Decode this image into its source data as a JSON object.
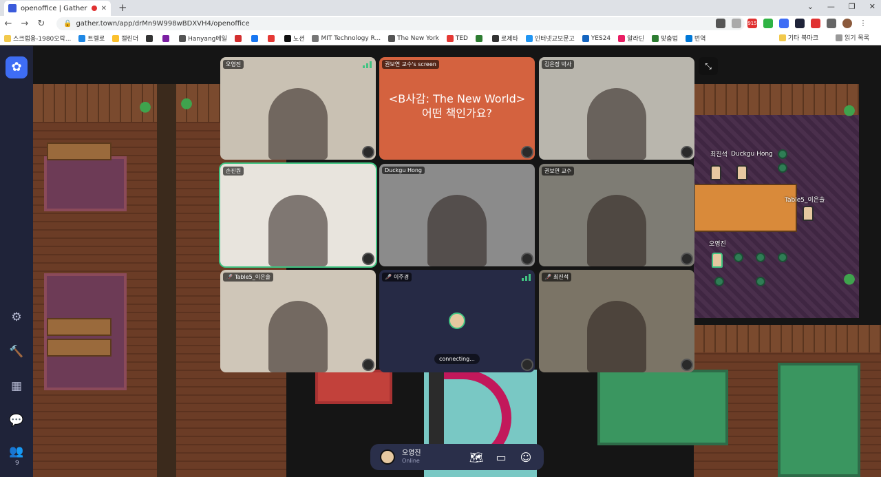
{
  "browser": {
    "tab_title": "openoffice | Gather",
    "url": "gather.town/app/drMn9W998wBDXVH4/openoffice",
    "bookmarks": [
      "스크랩용-1980오락...",
      "트렐로",
      "캘린더",
      "",
      "",
      "Hanyang메일",
      "",
      "",
      "",
      "노션",
      "MIT Technology R...",
      "The New York",
      "TED",
      "",
      "로제타",
      "인터넷교보문고",
      "YES24",
      "알라딘",
      "맞춤법",
      "번역"
    ],
    "bookmarks_right": [
      "기타 북마크",
      "읽기 목록"
    ],
    "ext_badge": "915"
  },
  "sidebar": {
    "items": [
      "settings-icon",
      "build-icon",
      "calendar-icon",
      "chat-icon",
      "participants-icon"
    ],
    "participant_count": "9"
  },
  "video_tiles": [
    {
      "name": "오영진",
      "muted": false,
      "bg": "#c9c1b3"
    },
    {
      "name": "권보연 교수's screen",
      "muted": false,
      "bg": "#d4623f",
      "screen_text": [
        "<B사감: The New World>",
        "어떤 책인가요?"
      ]
    },
    {
      "name": "김은정 박사",
      "muted": false,
      "bg": "#b9b6ad"
    },
    {
      "name": "손진원",
      "muted": false,
      "bg": "#e8e4dd"
    },
    {
      "name": "Duckgu Hong",
      "muted": false,
      "bg": "#8b8b8b"
    },
    {
      "name": "권보연 교수",
      "muted": false,
      "bg": "#7e7c74"
    },
    {
      "name": "Table5_이은솔",
      "muted": true,
      "bg": "#cfc6b8"
    },
    {
      "name": "이주경",
      "muted": true,
      "bg": "#262a45",
      "status": "connecting..."
    },
    {
      "name": "최진석",
      "muted": true,
      "bg": "#7b7466"
    }
  ],
  "map_labels": [
    "최진석",
    "Duckgu Hong",
    "Table5_이은솔",
    "오영진"
  ],
  "bottom_bar": {
    "name": "오영진",
    "status": "Online",
    "icons": [
      "map-icon",
      "screen-share-icon",
      "emoji-icon"
    ]
  }
}
